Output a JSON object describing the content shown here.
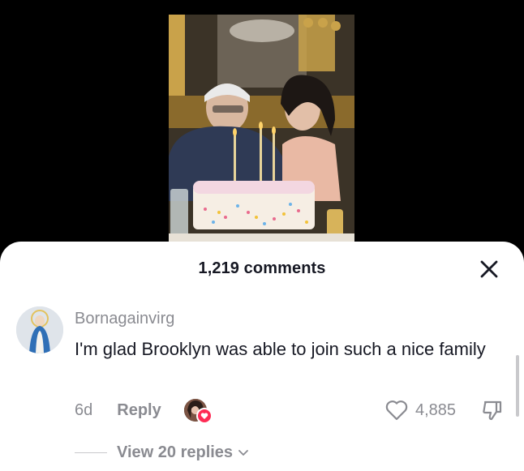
{
  "sheet": {
    "title": "1,219 comments",
    "close_icon": "close-icon"
  },
  "comment": {
    "username": "Bornagainvirg",
    "text": "I'm glad Brooklyn was able to join such a nice family",
    "time": "6d",
    "reply_label": "Reply",
    "like_count": "4,885",
    "like_icon": "heart-outline-icon",
    "dislike_icon": "thumbs-down-icon",
    "creator_liked": true
  },
  "replies": {
    "label": "View 20 replies",
    "chevron_icon": "chevron-down-icon"
  },
  "colors": {
    "background": "#000000",
    "sheet": "#ffffff",
    "primary_text": "#161823",
    "secondary_text": "#8a8b91",
    "accent_heart": "#fe2c55"
  }
}
